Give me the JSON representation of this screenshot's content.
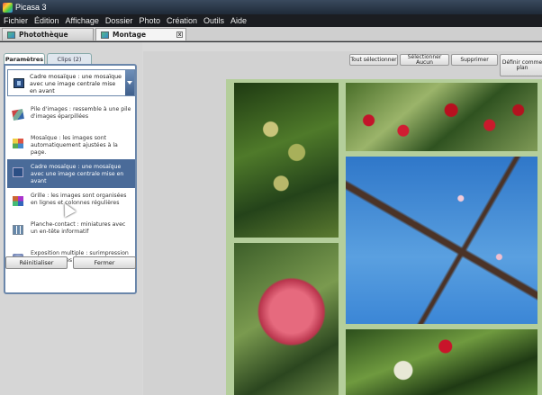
{
  "window": {
    "title": "Picasa 3"
  },
  "menu": [
    "Fichier",
    "Édition",
    "Affichage",
    "Dossier",
    "Photo",
    "Création",
    "Outils",
    "Aide"
  ],
  "tabs": {
    "library": "Photothèque",
    "montage": "Montage",
    "close_glyph": "x"
  },
  "panel": {
    "tabs": {
      "params": "Paramètres",
      "clips": "Clips (2)"
    },
    "dropdown": {
      "selected": "Cadre mosaïque : une mosaïque avec une image centrale mise en avant"
    },
    "options": [
      {
        "icon": "pile-icon",
        "label": "Pile d'images : ressemble à une pile d'images éparpillées"
      },
      {
        "icon": "mosaic-icon",
        "label": "Mosaïque : les images sont automatiquement ajustées à la page."
      },
      {
        "icon": "frame-mosaic-icon",
        "label": "Cadre mosaïque : une mosaïque avec une image centrale mise en avant",
        "selected": true
      },
      {
        "icon": "grid-icon",
        "label": "Grille : les images sont organisées en lignes et colonnes régulières"
      },
      {
        "icon": "contact-sheet-icon",
        "label": "Planche-contact : miniatures avec un en-tête informatif"
      },
      {
        "icon": "multiple-exposure-icon",
        "label": "Exposition multiple : surimpression des images les unes sur les autres"
      }
    ],
    "buttons": {
      "reset": "Réinitialiser",
      "close": "Fermer"
    }
  },
  "toolbar": {
    "select_all": "Tout sélectionner",
    "select_none": "Sélectionner Aucun",
    "delete": "Supprimer",
    "define": "Définir comme plan"
  },
  "colors": {
    "selection": "#4a6b99",
    "canvas": "#b4ce9b",
    "menubar": "#1b1d21"
  }
}
